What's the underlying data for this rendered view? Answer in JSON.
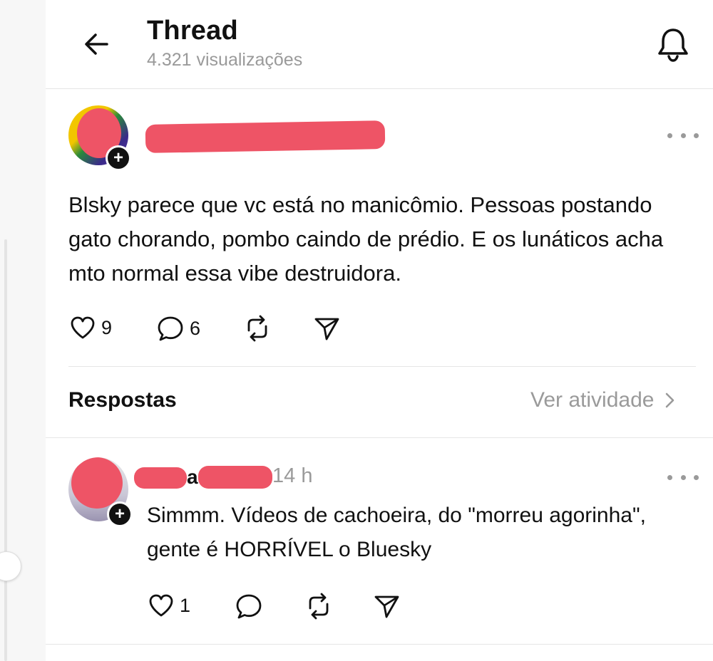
{
  "header": {
    "title": "Thread",
    "views": "4.321 visualizações"
  },
  "post": {
    "text": "Blsky parece que vc está no manicômio. Pessoas postando gato chorando, pombo caindo de prédio. E os lunáticos acha mto normal essa vibe destruidora.",
    "likes": "9",
    "replies": "6",
    "follow_symbol": "+"
  },
  "replies_section": {
    "title": "Respostas",
    "activity_link": "Ver atividade"
  },
  "reply": {
    "name_visible_fragment": "a",
    "time": "14 h",
    "text": "Simmm. Vídeos de cachoeira, do \"morreu agorinha\", gente é HORRÍVEL o Bluesky",
    "likes": "1",
    "follow_symbol": "+"
  },
  "icons": {
    "back": "arrow-left-icon",
    "bell": "bell-icon",
    "more": "more-horizontal-icon",
    "like": "heart-icon",
    "comment": "comment-icon",
    "repost": "repost-icon",
    "share": "send-icon",
    "chevron": "chevron-right-icon"
  },
  "colors": {
    "text": "#111111",
    "muted": "#9a9a9a",
    "redaction": "#ee5466",
    "divider": "#e6e6e6"
  }
}
